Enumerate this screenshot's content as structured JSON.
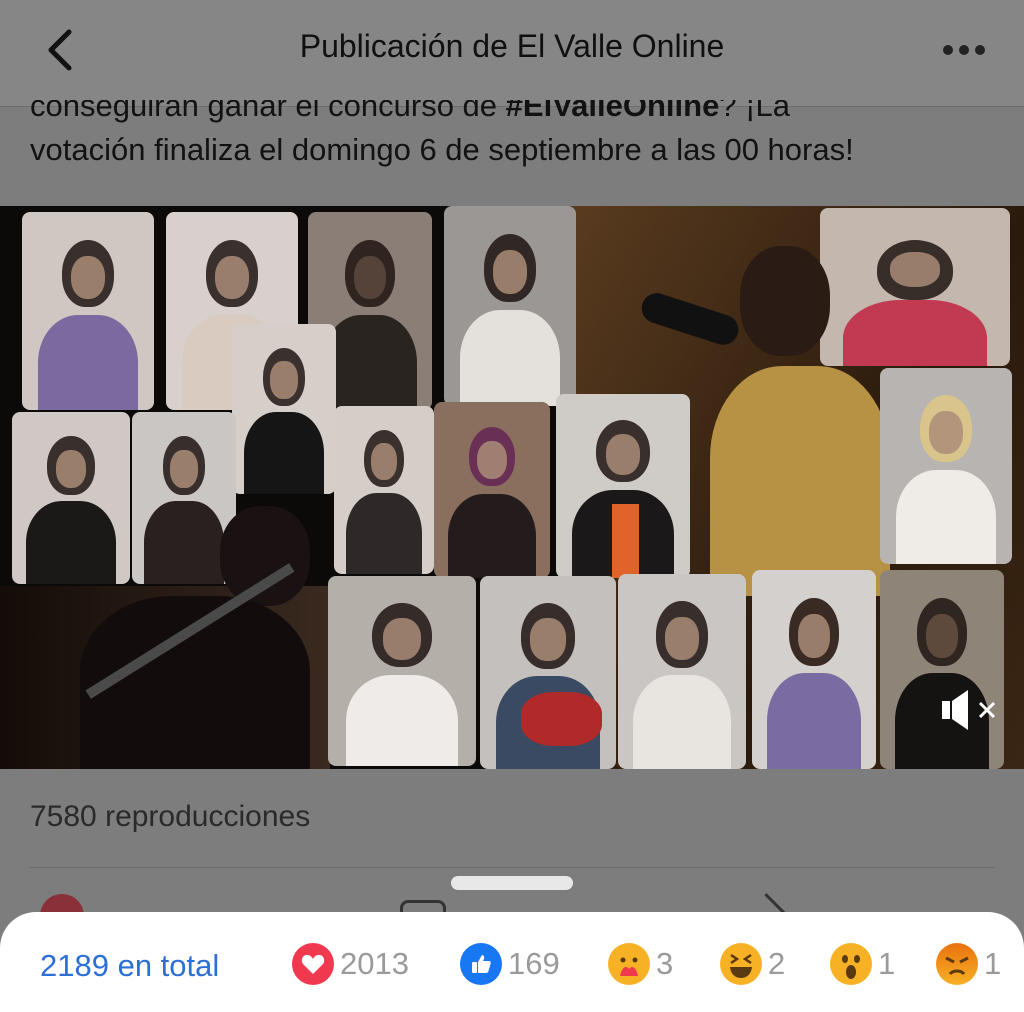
{
  "header": {
    "title": "Publicación de El Valle Online",
    "back_icon": "chevron-left-icon",
    "more_icon": "more-horizontal-icon"
  },
  "post": {
    "caption_line1_prefix": "conseguirán ganar el concurso de ",
    "caption_hashtag": "#ElValleOnline",
    "caption_line1_suffix": "? ¡La",
    "caption_line2": "votación finaliza el domingo 6 de septiembre a las 00 horas!",
    "views": "7580 reproducciones",
    "mute_icon": "speaker-muted-icon"
  },
  "reactions_sheet": {
    "total": "2189 en total",
    "reactions": [
      {
        "name": "love",
        "icon": "heart-reaction-icon",
        "count": "2013",
        "color": "#f0384f"
      },
      {
        "name": "like",
        "icon": "thumbs-up-reaction-icon",
        "count": "169",
        "color": "#1877f2"
      },
      {
        "name": "care",
        "icon": "care-reaction-icon",
        "count": "3",
        "color": "#f7b125"
      },
      {
        "name": "haha",
        "icon": "haha-reaction-icon",
        "count": "2",
        "color": "#f7b125"
      },
      {
        "name": "wow",
        "icon": "wow-reaction-icon",
        "count": "1",
        "color": "#f7b125"
      },
      {
        "name": "angry",
        "icon": "angry-reaction-icon",
        "count": "1",
        "color": "#e9710f"
      }
    ]
  }
}
